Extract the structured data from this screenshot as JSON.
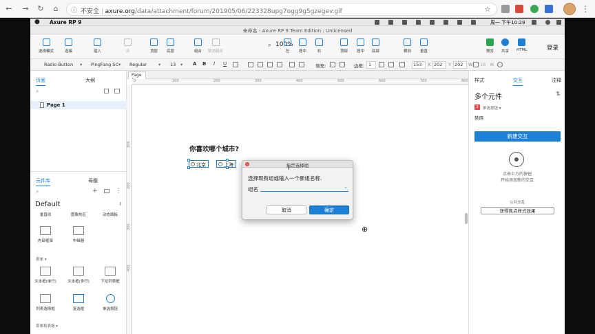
{
  "browser": {
    "url_prefix": "不安全",
    "url_domain": "axure.org",
    "url_path": "/data/attachment/forum/201905/06/223328upg7ogg9g5gzegev.gif",
    "star_icon": "☆"
  },
  "menubar": {
    "app_name": "Axure RP 9",
    "clock": "周一 下午10:29"
  },
  "window": {
    "title": "未命名 - Axure RP 9 Team Edition : Unlicensed"
  },
  "toolbar": {
    "items": [
      {
        "label": "选择模式"
      },
      {
        "label": "连接"
      },
      {
        "label": "插入"
      },
      {
        "label": "点"
      },
      {
        "label": "顶层"
      },
      {
        "label": "底层"
      },
      {
        "label": "组合"
      },
      {
        "label": "取消组合"
      },
      {
        "label": "左"
      },
      {
        "label": "居中"
      },
      {
        "label": "右"
      },
      {
        "label": "顶部"
      },
      {
        "label": "居中"
      },
      {
        "label": "底部"
      },
      {
        "label": "横向"
      },
      {
        "label": "垂直"
      },
      {
        "label": "预览"
      },
      {
        "label": "共享"
      },
      {
        "label": "HTML"
      }
    ],
    "zoom": "100%",
    "login": "登录"
  },
  "propbar": {
    "widget_type": "Radio Button",
    "font_family": "PingFang SC",
    "font_weight": "Regular",
    "font_size": "13",
    "fill_label": "填充:",
    "border_label": "边框:",
    "border_value": "1",
    "x_value": "153",
    "y_value": "202",
    "w_value": "202",
    "h_value": "18"
  },
  "left_panel": {
    "tab_pages": "页面",
    "tab_outline": "大纲",
    "page_name": "Page 1",
    "tab_library": "元件库",
    "tab_masters": "母版",
    "library_name": "Default",
    "top_items": [
      {
        "label": "垂直线"
      },
      {
        "label": "图像热区"
      },
      {
        "label": "动态面板"
      },
      {
        "label": "内部框架"
      },
      {
        "label": "中继器"
      }
    ],
    "section_form": "表单 ▾",
    "form_items": [
      {
        "label": "文本框(单行)"
      },
      {
        "label": "文本框(多行)"
      },
      {
        "label": "下拉列表框"
      },
      {
        "label": "列表选择框"
      },
      {
        "label": "复选框"
      },
      {
        "label": "单选按钮"
      }
    ],
    "section_menu": "菜单和表格 ▾"
  },
  "canvas": {
    "tab_name": "Page 1",
    "ruler_h": [
      "0",
      "100",
      "200",
      "300",
      "400",
      "500",
      "600",
      "700",
      "800"
    ],
    "ruler_v": [
      "100",
      "200",
      "300",
      "400"
    ],
    "question": "你喜欢哪个城市?",
    "radio1": "北京",
    "radio2": "上海"
  },
  "dialog": {
    "title": "指定选择组",
    "message": "选择现有组或输入一个新组名称.",
    "group_label": "组名",
    "group_value": "",
    "cancel": "取消",
    "ok": "确定"
  },
  "right_panel": {
    "tab_style": "样式",
    "tab_interaction": "交互",
    "tab_notes": "注释",
    "title": "多个元件",
    "badge": "3",
    "type_label": "单选按钮 ▾",
    "disabled": "禁用",
    "new_interaction": "新建交互",
    "hint1": "点击上方的按钮",
    "hint2": "开始添加新的交互",
    "public_interaction": "公共交互",
    "focus_style": "获得焦点样式效果"
  }
}
